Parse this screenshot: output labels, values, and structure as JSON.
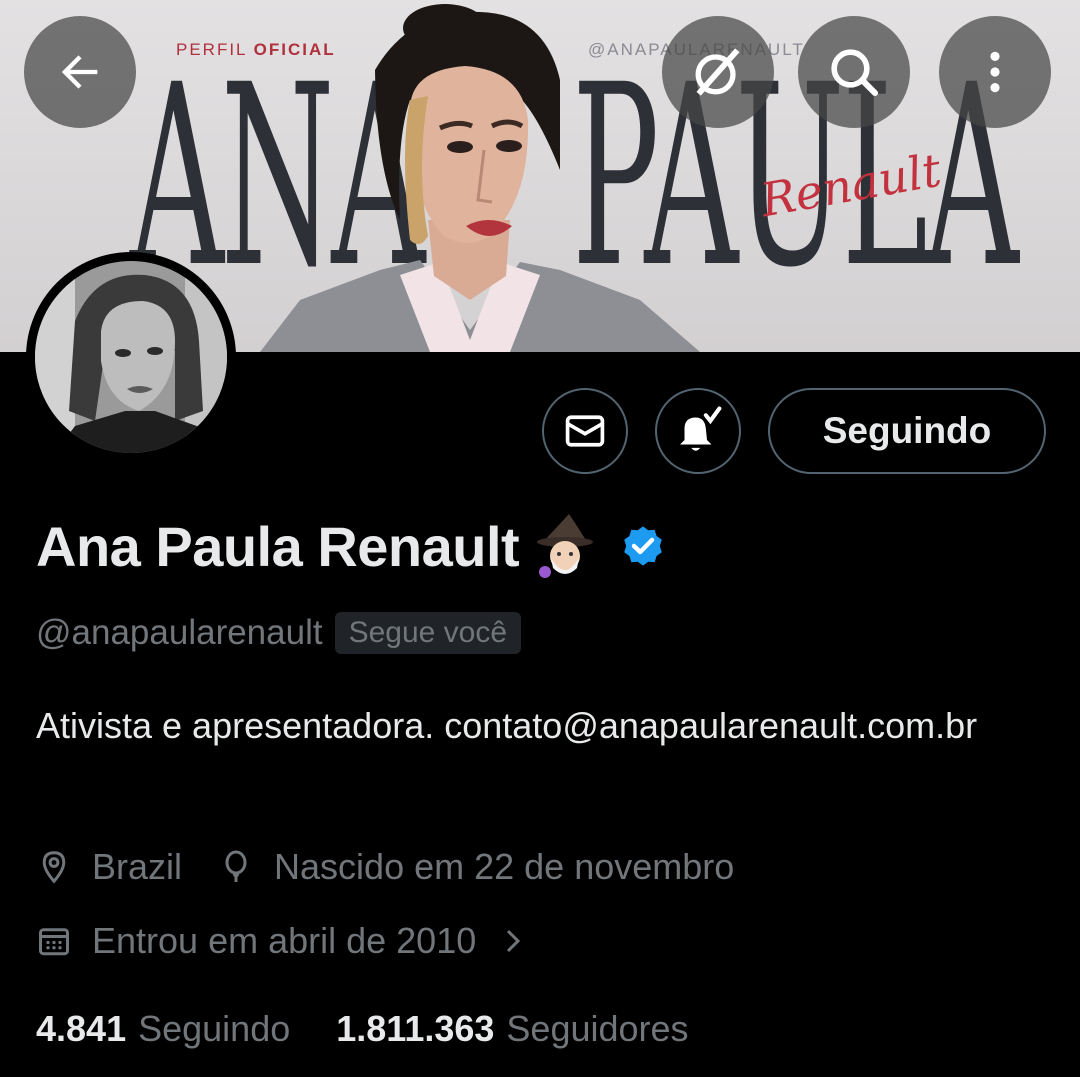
{
  "banner": {
    "perfil_prefix": "PERFIL ",
    "perfil_bold": "OFICIAL",
    "social_handle": "@ANAPAULARENAULT",
    "title_left": "ANA",
    "title_right": "PAULA",
    "script_name": "Renault"
  },
  "header": {
    "back_icon": "arrow-left-icon",
    "grok_icon": "grok-icon",
    "search_icon": "search-icon",
    "more_icon": "more-vertical-icon"
  },
  "actions": {
    "message_icon": "envelope-icon",
    "notify_icon": "bell-check-icon",
    "follow_label": "Seguindo"
  },
  "profile": {
    "name": "Ana Paula Renault",
    "name_emoji": "wizard-emoji",
    "verified": "verified-badge-icon",
    "handle": "@anapaularenault",
    "follows_you": "Segue você",
    "bio": "Ativista e apresentadora. contato@anapaularenault.com.br",
    "location": "Brazil",
    "birthday": "Nascido em 22 de novembro",
    "joined": "Entrou em abril de 2010"
  },
  "stats": {
    "following_count": "4.841",
    "following_label": "Seguindo",
    "followers_count": "1.811.363",
    "followers_label": "Seguidores"
  },
  "colors": {
    "background": "#000000",
    "text_primary": "#e7e9ea",
    "text_secondary": "#71767b",
    "border": "#536471",
    "verified": "#1d9bf0",
    "banner_accent": "#c2313d"
  }
}
